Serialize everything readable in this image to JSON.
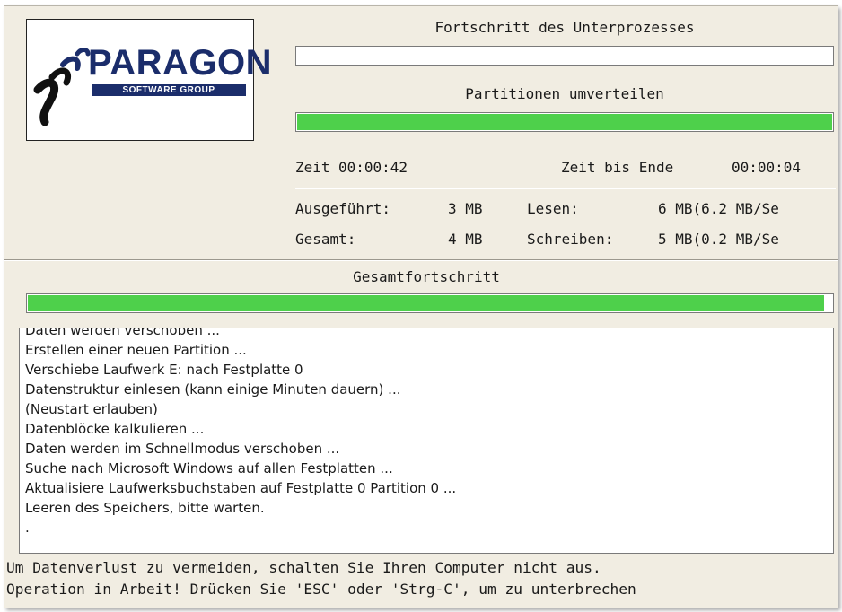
{
  "logo": {
    "brand": "PARAGON",
    "tagline": "SOFTWARE GROUP"
  },
  "subprocess": {
    "label": "Fortschritt des Unterprozesses",
    "progress": 0
  },
  "operation": {
    "label": "Partitionen umverteilen",
    "progress": 1.0
  },
  "time": {
    "elapsed_label": "Zeit",
    "elapsed_value": "00:00:42",
    "remaining_label": "Zeit bis Ende",
    "remaining_value": "00:00:04"
  },
  "stats": {
    "executed_label": "Ausgeführt:",
    "executed_value": "3 MB",
    "total_label": "Gesamt:",
    "total_value": "4 MB",
    "read_label": "Lesen:",
    "read_value": "6 MB(6.2 MB/Se",
    "write_label": "Schreiben:",
    "write_value": "5 MB(0.2 MB/Se"
  },
  "overall": {
    "label": "Gesamtfortschritt",
    "progress": 0.99
  },
  "log": [
    "Daten werden verschoben ...",
    "Erstellen einer neuen Partition ...",
    "Verschiebe Laufwerk E: nach Festplatte 0",
    "Datenstruktur einlesen (kann einige Minuten dauern) ...",
    "(Neustart erlauben)",
    "Datenblöcke kalkulieren ...",
    "Daten werden im Schnellmodus verschoben ...",
    "Suche nach Microsoft Windows auf allen Festplatten ...",
    "Aktualisiere Laufwerksbuchstaben auf Festplatte 0 Partition 0 ...",
    "Leeren des Speichers, bitte warten.",
    "."
  ],
  "footer": {
    "line1": "Um Datenverlust zu vermeiden, schalten Sie Ihren Computer nicht aus.",
    "line2": "Operation in Arbeit! Drücken Sie 'ESC' oder 'Strg-C', um zu unterbrechen"
  },
  "colors": {
    "progress_fill": "#4ed04b",
    "panel_bg": "#f1ede2",
    "logo_blue": "#1b2d6b"
  }
}
